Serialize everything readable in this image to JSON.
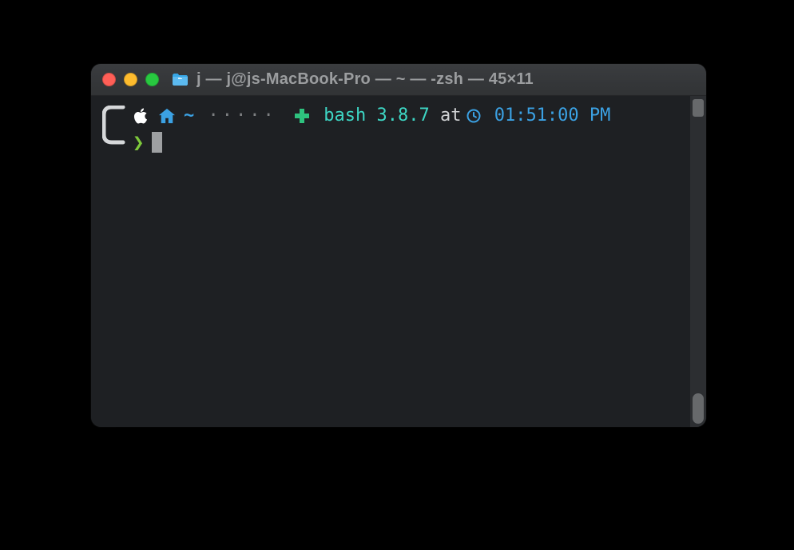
{
  "window": {
    "title": "j — j@js-MacBook-Pro — ~ — -zsh — 45×11"
  },
  "prompt": {
    "cwd": "~",
    "dots": "·····",
    "shell": "bash",
    "version": "3.8.7",
    "at": "at",
    "time": "01:51:00 PM",
    "chevron": "❯"
  },
  "icons": {
    "apple": "apple-icon",
    "house": "house-icon",
    "clock": "clock-icon",
    "cross": "green-cross-icon",
    "folder": "folder-icon"
  }
}
